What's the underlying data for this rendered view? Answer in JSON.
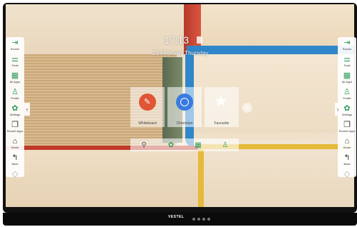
{
  "clock": {
    "time": "17:13",
    "date": "23 February Thursday"
  },
  "sidebar_left": [
    {
      "label": "Source",
      "icon": "source-icon"
    },
    {
      "label": "Tools",
      "icon": "tools-icon"
    },
    {
      "label": "All Apps",
      "icon": "apps-grid-icon"
    },
    {
      "label": "Profile",
      "icon": "profile-icon"
    },
    {
      "label": "Settings",
      "icon": "settings-icon"
    },
    {
      "label": "Recent Apps",
      "icon": "recent-apps-icon"
    },
    {
      "label": "Home",
      "icon": "home-icon"
    },
    {
      "label": "Back",
      "icon": "back-icon"
    },
    {
      "label": "",
      "icon": "more-icon"
    }
  ],
  "sidebar_right": [
    {
      "label": "Source",
      "icon": "source-icon"
    },
    {
      "label": "Tools",
      "icon": "tools-icon"
    },
    {
      "label": "All Apps",
      "icon": "apps-grid-icon"
    },
    {
      "label": "Profile",
      "icon": "profile-icon"
    },
    {
      "label": "Settings",
      "icon": "settings-icon"
    },
    {
      "label": "Recent Apps",
      "icon": "recent-apps-icon"
    },
    {
      "label": "Home",
      "icon": "home-icon"
    },
    {
      "label": "Back",
      "icon": "back-icon"
    },
    {
      "label": "",
      "icon": "more-icon"
    }
  ],
  "apps": [
    {
      "label": "Whiteboard",
      "icon": "pen-icon",
      "color": "#e05536"
    },
    {
      "label": "Chromium",
      "icon": "chromium-icon",
      "color": "#3a7be0"
    },
    {
      "label": "Favourite",
      "icon": "star-icon",
      "color": "#ffffff"
    }
  ],
  "dock": [
    {
      "icon": "search-icon"
    },
    {
      "icon": "settings-icon"
    },
    {
      "icon": "apps-grid-icon"
    },
    {
      "icon": "profile-icon"
    }
  ],
  "brand": {
    "logo": "VESTEL"
  },
  "colors": {
    "accent": "#2e9d5c"
  }
}
